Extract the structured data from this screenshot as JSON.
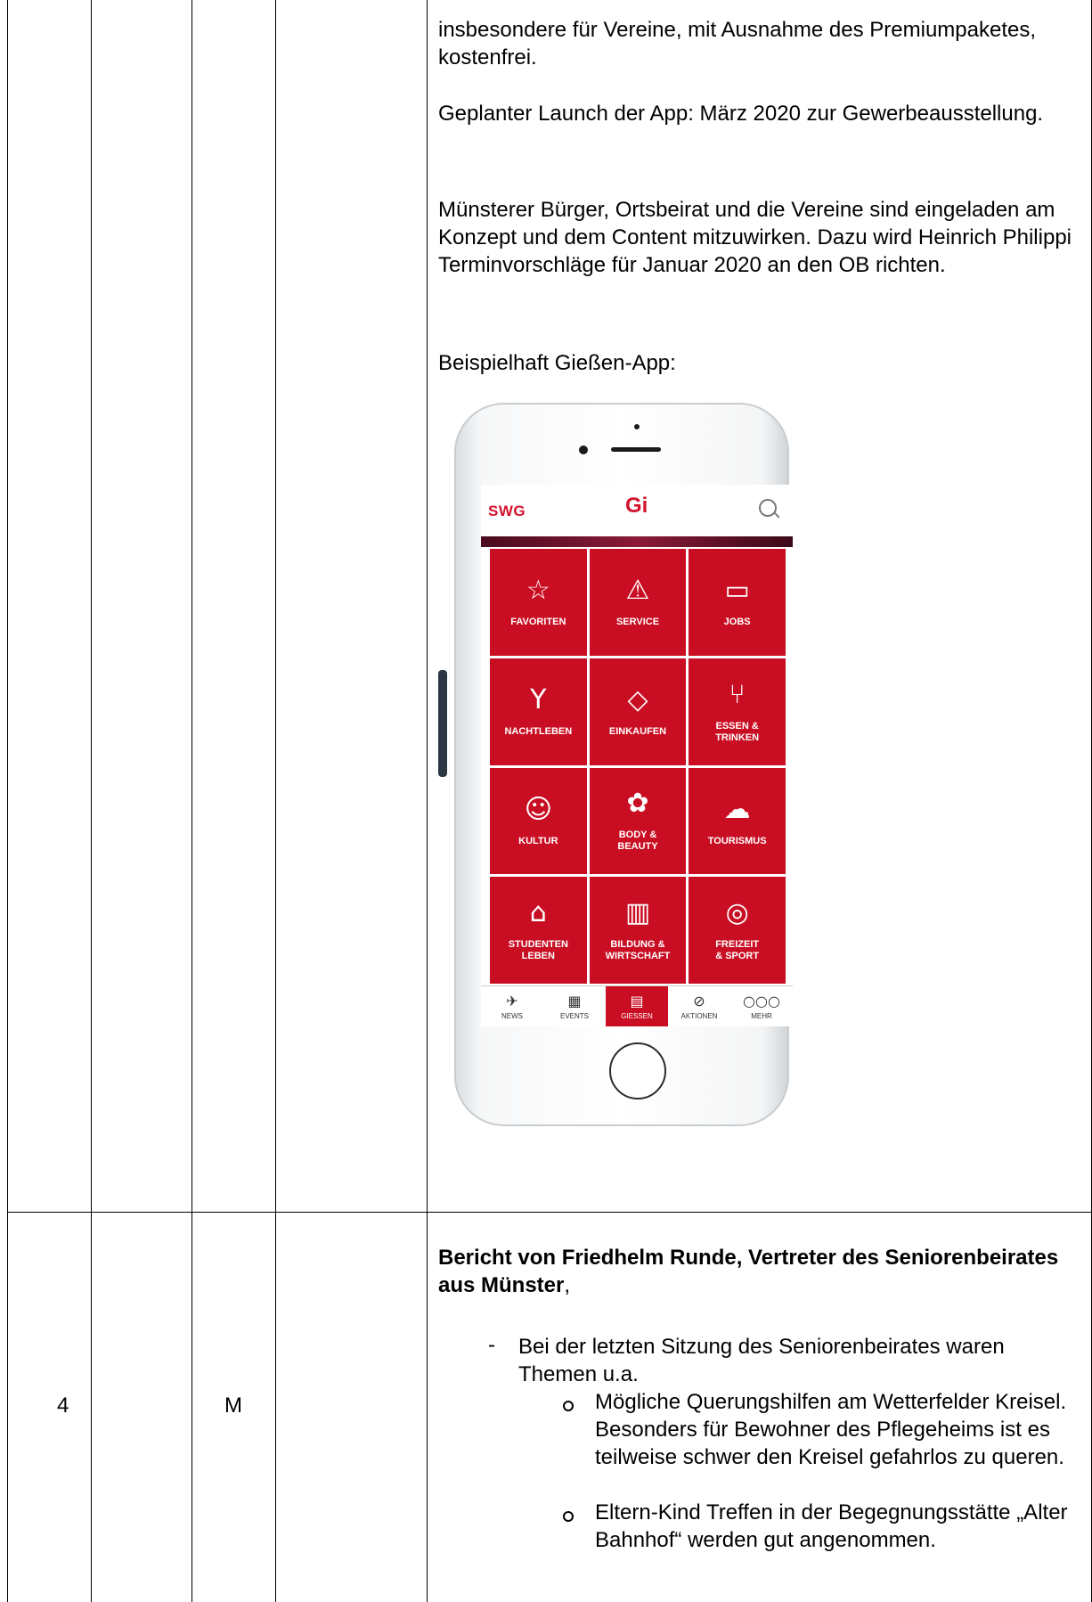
{
  "upper_cell": {
    "para1": "insbesondere für Vereine, mit Ausnahme des Premiumpaketes, kostenfrei.",
    "para2": "Geplanter Launch der App: März 2020 zur Gewerbeausstellung.",
    "para3": "Münsterer Bürger, Ortsbeirat und die Vereine sind eingeladen am Konzept und dem Content mitzuwirken. Dazu wird Heinrich Philippi Terminvorschläge für Januar 2020 an den OB richten.",
    "para4": "Beispielhaft Gießen-App:"
  },
  "phone_app": {
    "brand_left": "SWG",
    "brand_center": "Gi",
    "tiles": [
      {
        "icon": "star-icon",
        "glyph": "☆",
        "label": "FAVORITEN"
      },
      {
        "icon": "siren-icon",
        "glyph": "⚠",
        "label": "SERVICE"
      },
      {
        "icon": "briefcase-icon",
        "glyph": "▭",
        "label": "JOBS"
      },
      {
        "icon": "cocktail-glass-icon",
        "glyph": "Y",
        "label": "NACHTLEBEN"
      },
      {
        "icon": "shopping-bag-icon",
        "glyph": "◇",
        "label": "EINKAUFEN"
      },
      {
        "icon": "fork-knife-icon",
        "glyph": "⑂",
        "label": "ESSEN &\nTRINKEN"
      },
      {
        "icon": "theater-mask-icon",
        "glyph": "☺",
        "label": "KULTUR"
      },
      {
        "icon": "flower-icon",
        "glyph": "✿",
        "label": "BODY &\nBEAUTY"
      },
      {
        "icon": "landscape-icon",
        "glyph": "☁",
        "label": "TOURISMUS"
      },
      {
        "icon": "graduation-cap-icon",
        "glyph": "⌂",
        "label": "STUDENTEN\nLEBEN"
      },
      {
        "icon": "growth-chart-icon",
        "glyph": "▥",
        "label": "BILDUNG &\nWIRTSCHAFT"
      },
      {
        "icon": "target-icon",
        "glyph": "◎",
        "label": "FREIZEIT\n& SPORT"
      }
    ],
    "tabs": [
      {
        "icon": "paper-plane-icon",
        "glyph": "✈",
        "label": "NEWS"
      },
      {
        "icon": "calendar-icon",
        "glyph": "▦",
        "label": "EVENTS"
      },
      {
        "icon": "map-icon",
        "glyph": "▤",
        "label": "GIESSEN"
      },
      {
        "icon": "tag-icon",
        "glyph": "⊘",
        "label": "AKTIONEN"
      },
      {
        "icon": "more-dots-icon",
        "glyph": "○○○",
        "label": "MEHR"
      }
    ],
    "colors": {
      "brand_red": "#c90d22"
    }
  },
  "row4": {
    "number": "4",
    "col3": "M",
    "heading_bold": "Bericht von Friedhelm Runde, Vertreter des Seniorenbeirates aus Münster",
    "heading_tail": ",",
    "dash": "-",
    "bullet_intro": "Bei der letzten Sitzung des Seniorenbeirates waren Themen u.a.",
    "sub_items": [
      "Mögliche Querungshilfen am Wetterfelder Kreisel. Besonders für Bewohner des Pflegeheims ist es teilweise schwer den Kreisel gefahrlos zu queren.",
      "Eltern-Kind Treffen in der Begegnungsstätte „Alter Bahnhof“ werden gut angenommen."
    ]
  }
}
